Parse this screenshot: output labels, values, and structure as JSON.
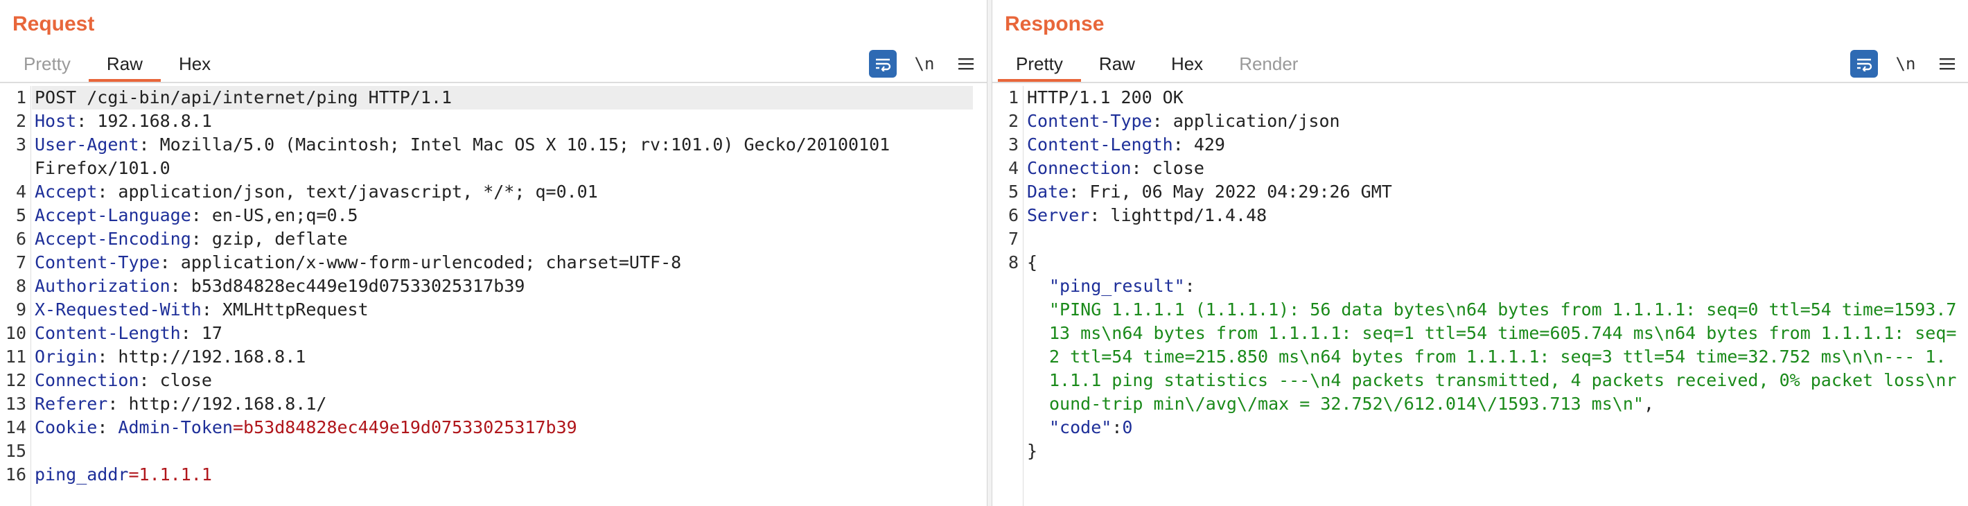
{
  "request": {
    "title": "Request",
    "tabs": [
      "Pretty",
      "Raw",
      "Hex"
    ],
    "active_tab": "Raw",
    "tool_newline": "\\n",
    "lines": [
      {
        "n": "1",
        "text": "POST /cgi-bin/api/internet/ping HTTP/1.1"
      },
      {
        "n": "2",
        "key": "Host",
        "val": ": 192.168.8.1"
      },
      {
        "n": "3",
        "key": "User-Agent",
        "val": ": Mozilla/5.0 (Macintosh; Intel Mac OS X 10.15; rv:101.0) Gecko/20100101"
      },
      {
        "n": "",
        "text": "Firefox/101.0"
      },
      {
        "n": "4",
        "key": "Accept",
        "val": ": application/json, text/javascript, */*; q=0.01"
      },
      {
        "n": "5",
        "key": "Accept-Language",
        "val": ": en-US,en;q=0.5"
      },
      {
        "n": "6",
        "key": "Accept-Encoding",
        "val": ": gzip, deflate"
      },
      {
        "n": "7",
        "key": "Content-Type",
        "val": ": application/x-www-form-urlencoded; charset=UTF-8"
      },
      {
        "n": "8",
        "key": "Authorization",
        "val": ": b53d84828ec449e19d07533025317b39"
      },
      {
        "n": "9",
        "key": "X-Requested-With",
        "val": ": XMLHttpRequest"
      },
      {
        "n": "10",
        "key": "Content-Length",
        "val": ": 17"
      },
      {
        "n": "11",
        "key": "Origin",
        "val": ": http://192.168.8.1"
      },
      {
        "n": "12",
        "key": "Connection",
        "val": ": close"
      },
      {
        "n": "13",
        "key": "Referer",
        "val": ": http://192.168.8.1/"
      },
      {
        "n": "14",
        "key": "Cookie",
        "val": ": ",
        "ckey": "Admin-Token",
        "cval": "=b53d84828ec449e19d07533025317b39"
      },
      {
        "n": "15",
        "text": ""
      },
      {
        "n": "16",
        "pkey": "ping_addr",
        "pval": "=1.1.1.1"
      }
    ]
  },
  "response": {
    "title": "Response",
    "tabs": [
      "Pretty",
      "Raw",
      "Hex",
      "Render"
    ],
    "active_tab": "Pretty",
    "tool_newline": "\\n",
    "lines": [
      {
        "n": "1",
        "text": "HTTP/1.1 200 OK"
      },
      {
        "n": "2",
        "key": "Content-Type",
        "val": ": application/json"
      },
      {
        "n": "3",
        "key": "Content-Length",
        "val": ": 429"
      },
      {
        "n": "4",
        "key": "Connection",
        "val": ": close"
      },
      {
        "n": "5",
        "key": "Date",
        "val": ": Fri, 06 May 2022 04:29:26 GMT"
      },
      {
        "n": "6",
        "key": "Server",
        "val": ": lighttpd/1.4.48"
      },
      {
        "n": "7",
        "text": ""
      },
      {
        "n": "8",
        "text": "{"
      }
    ],
    "json_key_ping": "\"ping_result\"",
    "json_colon": ":",
    "json_ping_value": "\"PING 1.1.1.1 (1.1.1.1): 56 data bytes\\n64 bytes from 1.1.1.1: seq=0 ttl=54 time=1593.713 ms\\n64 bytes from 1.1.1.1: seq=1 ttl=54 time=605.744 ms\\n64 bytes from 1.1.1.1: seq=2 ttl=54 time=215.850 ms\\n64 bytes from 1.1.1.1: seq=3 ttl=54 time=32.752 ms\\n\\n--- 1.1.1.1 ping statistics ---\\n4 packets transmitted, 4 packets received, 0% packet loss\\nround-trip min\\/avg\\/max = 32.752\\/612.014\\/1593.713 ms\\n\"",
    "json_comma": ",",
    "json_key_code": "\"code\"",
    "json_code_value": "0",
    "json_close": "}"
  },
  "colors": {
    "accent": "#e8663a",
    "wrap_button": "#2e6ab3",
    "header_key": "#1e2f99",
    "cookie_value": "#b0161b",
    "json_string": "#1a8a1a"
  }
}
